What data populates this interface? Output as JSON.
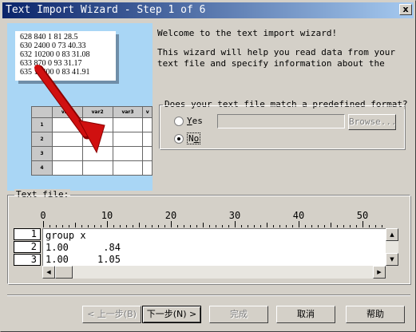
{
  "window": {
    "title": "Text Import Wizard - Step 1 of 6",
    "close_glyph": "x"
  },
  "illustration": {
    "sample_lines": [
      "628 840 1 81 28.5",
      "630 2400 0 73 40.33",
      "632 10200 0 83 31.08",
      "633 870 0 93 31.17",
      "635 17400 0 83 41.91"
    ],
    "grid_headers": [
      "var1",
      "var2",
      "var3",
      "v"
    ],
    "grid_rows": [
      "1",
      "2",
      "3",
      "4"
    ],
    "arrow_color": "#d01010"
  },
  "welcome": {
    "line1": "Welcome to the text import wizard!",
    "line2": "This wizard will help you read data from your text file and specify information about the"
  },
  "format_group": {
    "legend": "Does your text file match a predefined format?",
    "yes_label": "Yes",
    "yes_mnemonic": "Y",
    "no_label": "No",
    "no_mnemonic": "o",
    "selected": "No",
    "browse_label": "Browse..."
  },
  "text_file": {
    "legend": "Text file:",
    "ruler_labels": [
      "0",
      "10",
      "20",
      "30",
      "40",
      "50"
    ],
    "line_numbers": [
      "1",
      "2",
      "3"
    ],
    "lines": [
      "group x",
      "1.00      .84",
      "1.00     1.05"
    ]
  },
  "buttons": {
    "back": "< 上一步(B)",
    "next": "下一步(N) >",
    "finish": "完成",
    "cancel": "取消",
    "help": "帮助"
  },
  "colors": {
    "title_start": "#0a246a",
    "title_end": "#a6caf0",
    "illustration_bg": "#a9d6f5"
  }
}
